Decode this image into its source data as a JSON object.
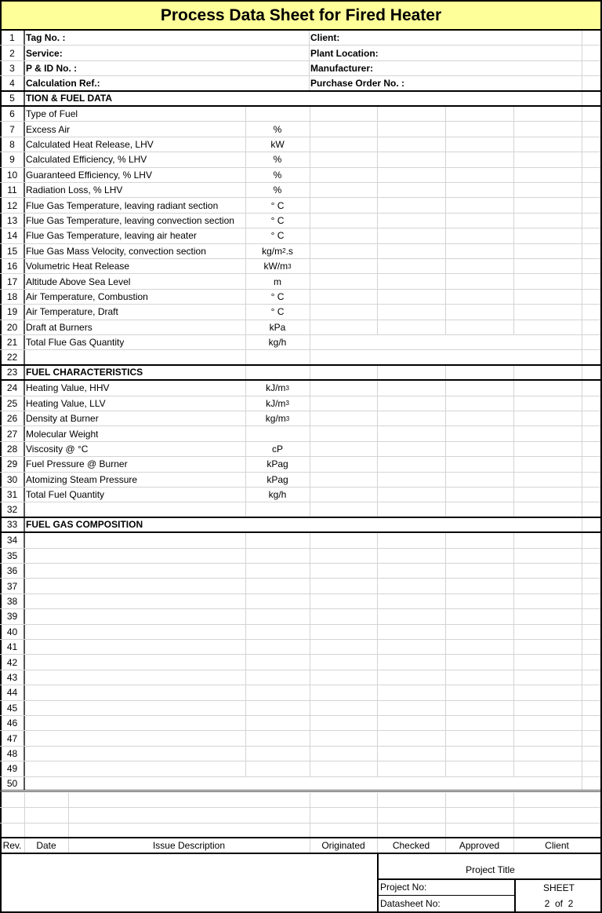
{
  "title": "Process Data Sheet for Fired Heater",
  "header_rows": [
    {
      "num": "1",
      "left": "Tag No. :",
      "right": "Client:"
    },
    {
      "num": "2",
      "left": "Service:",
      "right": "Plant Location:"
    },
    {
      "num": "3",
      "left": "P & ID No. :",
      "right": "Manufacturer:"
    },
    {
      "num": "4",
      "left": "Calculation Ref.:",
      "right": "Purchase Order No. :"
    }
  ],
  "sections": {
    "combustion": {
      "num": "5",
      "title": "TION & FUEL DATA"
    },
    "fuel_char": {
      "num": "23",
      "title": "FUEL CHARACTERISTICS"
    },
    "fuel_gas": {
      "num": "33",
      "title": "FUEL GAS COMPOSITION"
    }
  },
  "combustion_rows": [
    {
      "num": "6",
      "label": "Type of Fuel",
      "unit": "",
      "sup": ""
    },
    {
      "num": "7",
      "label": "Excess Air",
      "unit": "%",
      "sup": ""
    },
    {
      "num": "8",
      "label": "Calculated Heat Release, LHV",
      "unit": "kW",
      "sup": ""
    },
    {
      "num": "9",
      "label": "Calculated Efficiency, % LHV",
      "unit": "%",
      "sup": ""
    },
    {
      "num": "10",
      "label": "Guaranteed Efficiency, % LHV",
      "unit": "%",
      "sup": ""
    },
    {
      "num": "11",
      "label": "Radiation Loss, % LHV",
      "unit": "%",
      "sup": ""
    },
    {
      "num": "12",
      "label": "Flue Gas Temperature, leaving radiant section",
      "unit": "° C",
      "sup": ""
    },
    {
      "num": "13",
      "label": "Flue Gas Temperature, leaving convection section",
      "unit": "° C",
      "sup": ""
    },
    {
      "num": "14",
      "label": "Flue Gas Temperature, leaving air heater",
      "unit": "° C",
      "sup": ""
    },
    {
      "num": "15",
      "label": "Flue Gas Mass Velocity, convection section",
      "unit": "kg/m",
      "sup": "2",
      "suffix": " .s"
    },
    {
      "num": "16",
      "label": "Volumetric Heat Release",
      "unit": "kW/m",
      "sup": "3"
    },
    {
      "num": "17",
      "label": "Altitude Above Sea Level",
      "unit": "m",
      "sup": ""
    },
    {
      "num": "18",
      "label": "Air Temperature, Combustion",
      "unit": "° C",
      "sup": ""
    },
    {
      "num": "19",
      "label": "Air Temperature, Draft",
      "unit": "° C",
      "sup": ""
    },
    {
      "num": "20",
      "label": "Draft at Burners",
      "unit": "kPa",
      "sup": ""
    },
    {
      "num": "21",
      "label": "Total Flue Gas Quantity",
      "unit": "kg/h",
      "sup": ""
    },
    {
      "num": "22",
      "label": "",
      "unit": "",
      "sup": ""
    }
  ],
  "fuel_rows": [
    {
      "num": "24",
      "label": "Heating Value, HHV",
      "unit": "kJ/m",
      "sup": "3"
    },
    {
      "num": "25",
      "label": "Heating Value, LLV",
      "unit": "kJ/m",
      "sup": "3"
    },
    {
      "num": "26",
      "label": "Density at Burner",
      "unit": "kg/m",
      "sup": "3"
    },
    {
      "num": "27",
      "label": "Molecular Weight",
      "unit": "",
      "sup": ""
    },
    {
      "num": "28",
      "label": "Viscosity @   °C",
      "unit": "cP",
      "sup": ""
    },
    {
      "num": "29",
      "label": "Fuel Pressure @ Burner",
      "unit": "kPag",
      "sup": ""
    },
    {
      "num": "30",
      "label": "Atomizing Steam Pressure",
      "unit": "kPag",
      "sup": ""
    },
    {
      "num": "31",
      "label": "Total Fuel Quantity",
      "unit": "kg/h",
      "sup": ""
    },
    {
      "num": "32",
      "label": "",
      "unit": "",
      "sup": ""
    }
  ],
  "gas_rows": [
    "34",
    "35",
    "36",
    "37",
    "38",
    "39",
    "40",
    "41",
    "42",
    "43",
    "44",
    "45",
    "46",
    "47",
    "48",
    "49",
    "50"
  ],
  "revision_table": {
    "headers": [
      "Rev.",
      "Date",
      "Issue Description",
      "Originated",
      "Checked",
      "Approved",
      "Client"
    ]
  },
  "title_block": {
    "project_title_label": "Project Title",
    "project_no_label": "Project No:",
    "datasheet_no_label": "Datasheet No:",
    "sheet_label": "SHEET",
    "sheet_value": "2  of  2"
  }
}
